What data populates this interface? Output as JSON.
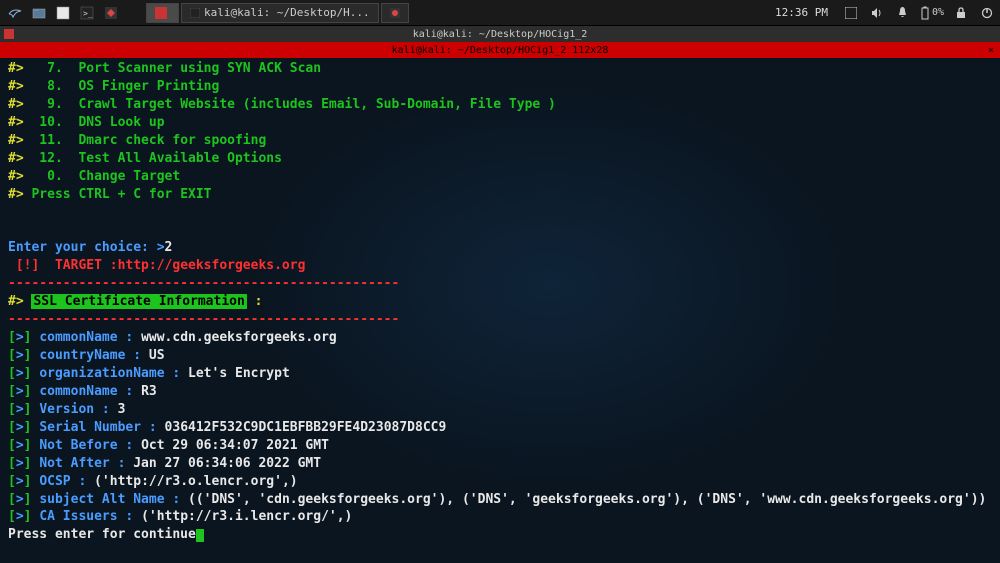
{
  "panel": {
    "taskbar_items": [
      "",
      "kali@kali: ~/Desktop/H..."
    ],
    "clock": "12:36 PM",
    "battery": "0%"
  },
  "titlebar": {
    "title": "kali@kali: ~/Desktop/HOCig1_2"
  },
  "tabbar": {
    "label": "kali@kali: ~/Desktop/HOCig1_2 112x28"
  },
  "menu": {
    "items": [
      {
        "num": "7.",
        "text": "Port Scanner using SYN ACK Scan"
      },
      {
        "num": "8.",
        "text": "OS Finger Printing"
      },
      {
        "num": "9.",
        "text": "Crawl Target Website (includes Email, Sub-Domain, File Type )"
      },
      {
        "num": "10.",
        "text": "DNS Look up"
      },
      {
        "num": "11.",
        "text": "Dmarc check for spoofing"
      },
      {
        "num": "12.",
        "text": "Test All Available Options"
      },
      {
        "num": "0.",
        "text": "Change Target"
      }
    ],
    "exit": "Press CTRL + C for EXIT"
  },
  "prompt": {
    "label": "Enter your choice: >",
    "value": "2"
  },
  "target": {
    "prefix": "[!]  TARGET :",
    "url": "http://geeksforgeeks.org"
  },
  "section": {
    "prefix": "#> ",
    "title": "SSL Certificate Information",
    "suffix": " :"
  },
  "dashline": "--------------------------------------------------",
  "ssl": [
    {
      "k": "commonName",
      "v": "www.cdn.geeksforgeeks.org"
    },
    {
      "k": "countryName",
      "v": "US"
    },
    {
      "k": "organizationName",
      "v": "Let's Encrypt"
    },
    {
      "k": "commonName",
      "v": "R3"
    },
    {
      "k": "Version",
      "v": "3"
    },
    {
      "k": "Serial Number",
      "v": "036412F532C9DC1EBFBB29FE4D23087D8CC9"
    },
    {
      "k": "Not Before",
      "v": "Oct 29 06:34:07 2021 GMT"
    },
    {
      "k": "Not After",
      "v": "Jan 27 06:34:06 2022 GMT"
    },
    {
      "k": "OCSP",
      "v": "('http://r3.o.lencr.org',)"
    },
    {
      "k": "subject Alt Name",
      "v": "(('DNS', 'cdn.geeksforgeeks.org'), ('DNS', 'geeksforgeeks.org'), ('DNS', 'www.cdn.geeksforgeeks.org'))"
    },
    {
      "k": "CA Issuers",
      "v": "('http://r3.i.lencr.org/',)"
    }
  ],
  "continue": "Press enter for continue"
}
